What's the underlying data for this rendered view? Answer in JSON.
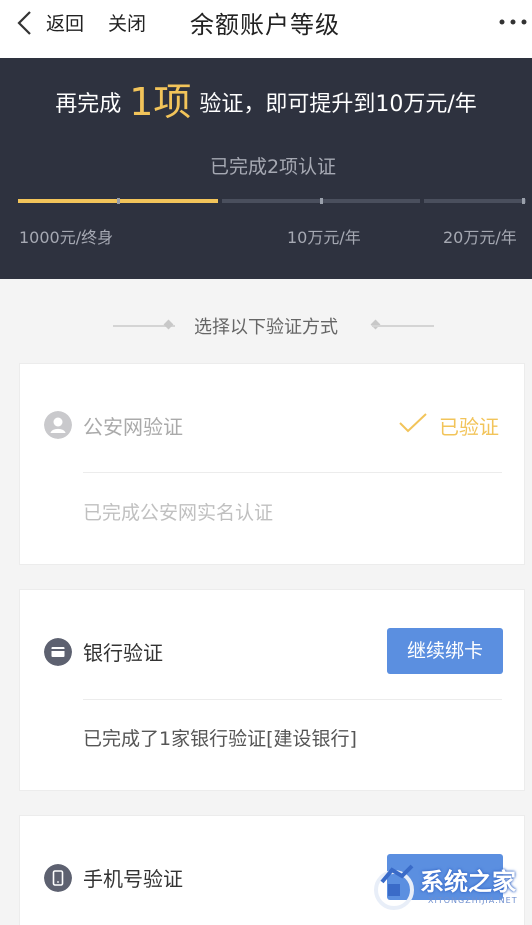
{
  "nav": {
    "back_label": "返回",
    "close_label": "关闭",
    "title": "余额账户等级"
  },
  "header": {
    "prefix": "再完成",
    "count": "1项",
    "suffix": "验证，即可提升到10万元/年",
    "completed": "已完成2项认证",
    "progress_fraction": 0.4,
    "tiers": [
      "1000元/终身",
      "10万元/年",
      "20万元/年"
    ]
  },
  "section": {
    "title": "选择以下验证方式"
  },
  "cards": [
    {
      "name": "公安网验证",
      "status": "已验证",
      "desc": "已完成公安网实名认证"
    },
    {
      "name": "银行验证",
      "action": "继续绑卡",
      "desc": "已完成了1家银行验证[建设银行]"
    },
    {
      "name": "手机号验证",
      "action": ""
    }
  ],
  "watermark": {
    "text": "系统之家",
    "sub": "XITONGZHIJIA.NET"
  },
  "colors": {
    "header_bg": "#2e323f",
    "accent_gold": "#f2c45a",
    "button_blue": "#5b8fe0",
    "page_bg": "#f4f4f4"
  },
  "icons": [
    "back-icon",
    "more-icon",
    "user-icon",
    "check-icon",
    "bank-card-icon",
    "phone-icon"
  ]
}
